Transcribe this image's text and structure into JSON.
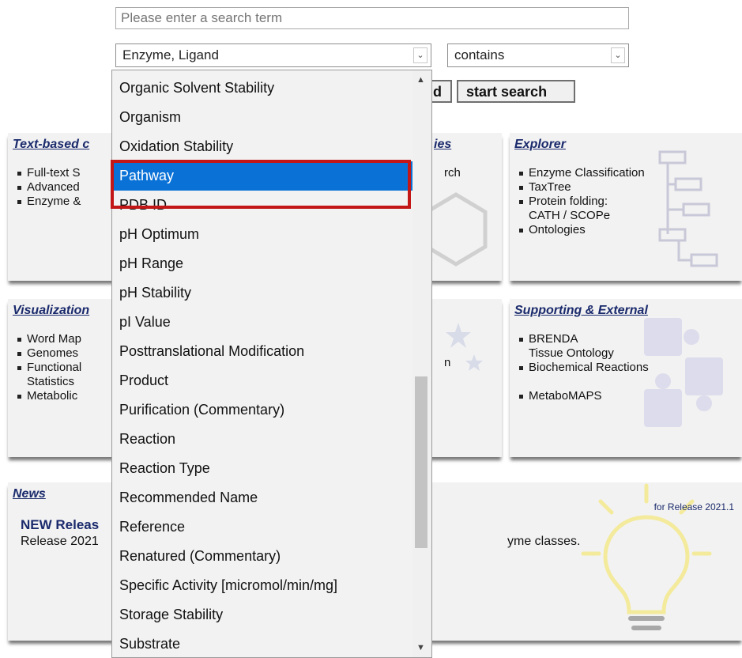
{
  "search": {
    "placeholder": "Please enter a search term"
  },
  "field_select": {
    "value": "Enzyme, Ligand"
  },
  "operator_select": {
    "value": "contains"
  },
  "buttons": {
    "partial_label": "d",
    "start_search": "start search"
  },
  "panels": {
    "text_based": {
      "title": "Text-based c",
      "items": [
        "Full-text S",
        "Advanced",
        "Enzyme &"
      ]
    },
    "structure": {
      "title": "ies",
      "item": "rch"
    },
    "explorer": {
      "title": "Explorer",
      "items": [
        "Enzyme Classification",
        "TaxTree",
        "Protein folding:",
        "CATH / SCOPe",
        "Ontologies"
      ]
    },
    "visualization": {
      "title": "Visualization",
      "items": [
        "Word Map",
        "Genomes",
        "Functional",
        "Statistics",
        "Metabolic"
      ]
    },
    "middle2": {
      "item": "n"
    },
    "supporting": {
      "title": "Supporting & External",
      "items": [
        "BRENDA",
        "Tissue Ontology",
        "Biochemical Reactions",
        "MetaboMAPS"
      ]
    },
    "news": {
      "title": "News",
      "heading": "NEW Releas",
      "text": "Release 2021",
      "text_right": "yme classes.",
      "release_note": "for Release 2021.1"
    }
  },
  "dropdown": {
    "items": [
      "Organic Solvent Stability",
      "Organism",
      "Oxidation Stability",
      "Pathway",
      "PDB ID",
      "pH Optimum",
      "pH Range",
      "pH Stability",
      "pI Value",
      "Posttranslational Modification",
      "Product",
      "Purification (Commentary)",
      "Reaction",
      "Reaction Type",
      "Recommended Name",
      "Reference",
      "Renatured (Commentary)",
      "Specific Activity [micromol/min/mg]",
      "Storage Stability",
      "Substrate"
    ],
    "selected": "Pathway",
    "highlight_color": "#c31717",
    "selection_color": "#0a72d7"
  }
}
